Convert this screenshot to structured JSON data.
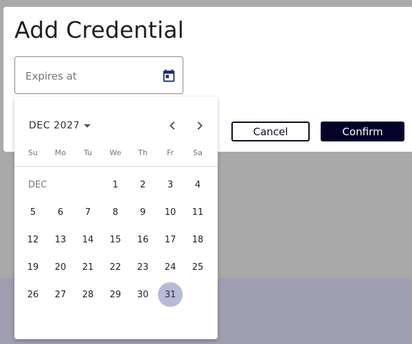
{
  "dialog": {
    "title": "Add Credential",
    "expires_field": {
      "placeholder": "Expires at",
      "value": ""
    },
    "cancel_label": "Cancel",
    "confirm_label": "Confirm"
  },
  "datepicker": {
    "period_label": "DEC 2027",
    "month_label": "DEC",
    "weekdays": [
      "Su",
      "Mo",
      "Tu",
      "We",
      "Th",
      "Fr",
      "Sa"
    ],
    "first_weekday_index": 3,
    "days_in_month": 31,
    "selected_day": 31
  },
  "colors": {
    "primary": "#03032a",
    "selected_day": "#b9b9d8",
    "backdrop": "#a9a9a9"
  },
  "icons": {
    "calendar": "calendar-icon",
    "prev": "chevron-left-icon",
    "next": "chevron-right-icon",
    "dropdown": "caret-down-icon"
  }
}
